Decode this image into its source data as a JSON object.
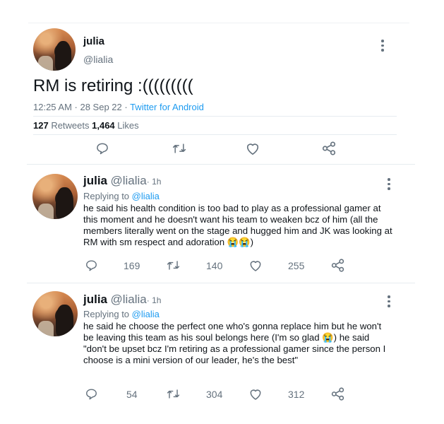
{
  "main_tweet": {
    "name": "julia",
    "handle": "@lialia",
    "text": "RM is retiring :(((((((((",
    "time": "12:25 AM · 28 Sep 22 · ",
    "source": "Twitter for Android",
    "retweets_count": "127",
    "retweets_label": " Retweets ",
    "likes_count": "1,464",
    "likes_label": " Likes"
  },
  "replies": [
    {
      "name": "julia",
      "handle": "@lialia",
      "time": "· 1h",
      "replying_prefix": "Replying to ",
      "replying_to": "@lialia",
      "text": "he said his health condition is too bad to play as a professional gamer at this moment and he doesn't want his team to weaken bcz of him (all the members literally went on the stage and hugged him and JK was looking at RM with sm respect and adoration 😭😭)",
      "reply_count": "169",
      "retweet_count": "140",
      "like_count": "255"
    },
    {
      "name": "julia",
      "handle": "@lialia",
      "time": "· 1h",
      "replying_prefix": "Replying to ",
      "replying_to": "@lialia",
      "text": "he said he choose the perfect one who's gonna replace him but he won't be leaving this team as his soul belongs here (I'm so glad 😭) he said \"don't be upset bcz I'm retiring as a professional gamer since the person I choose is a mini version of our leader, he's the best\"",
      "reply_count": "54",
      "retweet_count": "304",
      "like_count": "312"
    }
  ],
  "icons": {
    "reply": "reply-icon",
    "retweet": "retweet-icon",
    "like": "heart-icon",
    "share": "share-icon",
    "more": "more-icon"
  },
  "colors": {
    "accent": "#1d9bf0",
    "secondary_text": "#65727e",
    "divider": "#e6ecf0"
  }
}
